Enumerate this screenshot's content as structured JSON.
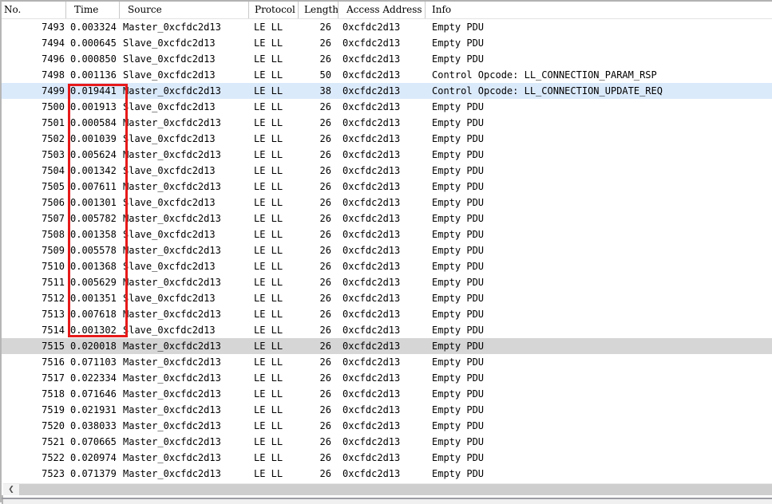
{
  "table": {
    "columns": [
      {
        "id": "no",
        "label": "No."
      },
      {
        "id": "time",
        "label": "Time"
      },
      {
        "id": "source",
        "label": "Source"
      },
      {
        "id": "protocol",
        "label": "Protocol"
      },
      {
        "id": "length",
        "label": "Length"
      },
      {
        "id": "access",
        "label": "Access Address"
      },
      {
        "id": "info",
        "label": "Info"
      }
    ],
    "rows": [
      {
        "no": "7493",
        "time": "0.003324",
        "source": "Master_0xcfdc2d13",
        "protocol": "LE LL",
        "length": "26",
        "access": "0xcfdc2d13",
        "info": "Empty PDU",
        "state": "normal"
      },
      {
        "no": "7494",
        "time": "0.000645",
        "source": "Slave_0xcfdc2d13",
        "protocol": "LE LL",
        "length": "26",
        "access": "0xcfdc2d13",
        "info": "Empty PDU",
        "state": "normal"
      },
      {
        "no": "7496",
        "time": "0.000850",
        "source": "Slave_0xcfdc2d13",
        "protocol": "LE LL",
        "length": "26",
        "access": "0xcfdc2d13",
        "info": "Empty PDU",
        "state": "normal"
      },
      {
        "no": "7498",
        "time": "0.001136",
        "source": "Slave_0xcfdc2d13",
        "protocol": "LE LL",
        "length": "50",
        "access": "0xcfdc2d13",
        "info": "Control Opcode: LL_CONNECTION_PARAM_RSP",
        "state": "normal"
      },
      {
        "no": "7499",
        "time": "0.019441",
        "source": "Master_0xcfdc2d13",
        "protocol": "LE LL",
        "length": "38",
        "access": "0xcfdc2d13",
        "info": "Control Opcode: LL_CONNECTION_UPDATE_REQ",
        "state": "selected-blue"
      },
      {
        "no": "7500",
        "time": "0.001913",
        "source": "Slave_0xcfdc2d13",
        "protocol": "LE LL",
        "length": "26",
        "access": "0xcfdc2d13",
        "info": "Empty PDU",
        "state": "normal"
      },
      {
        "no": "7501",
        "time": "0.000584",
        "source": "Master_0xcfdc2d13",
        "protocol": "LE LL",
        "length": "26",
        "access": "0xcfdc2d13",
        "info": "Empty PDU",
        "state": "normal"
      },
      {
        "no": "7502",
        "time": "0.001039",
        "source": "Slave_0xcfdc2d13",
        "protocol": "LE LL",
        "length": "26",
        "access": "0xcfdc2d13",
        "info": "Empty PDU",
        "state": "normal"
      },
      {
        "no": "7503",
        "time": "0.005624",
        "source": "Master_0xcfdc2d13",
        "protocol": "LE LL",
        "length": "26",
        "access": "0xcfdc2d13",
        "info": "Empty PDU",
        "state": "normal"
      },
      {
        "no": "7504",
        "time": "0.001342",
        "source": "Slave_0xcfdc2d13",
        "protocol": "LE LL",
        "length": "26",
        "access": "0xcfdc2d13",
        "info": "Empty PDU",
        "state": "normal"
      },
      {
        "no": "7505",
        "time": "0.007611",
        "source": "Master_0xcfdc2d13",
        "protocol": "LE LL",
        "length": "26",
        "access": "0xcfdc2d13",
        "info": "Empty PDU",
        "state": "normal"
      },
      {
        "no": "7506",
        "time": "0.001301",
        "source": "Slave_0xcfdc2d13",
        "protocol": "LE LL",
        "length": "26",
        "access": "0xcfdc2d13",
        "info": "Empty PDU",
        "state": "normal"
      },
      {
        "no": "7507",
        "time": "0.005782",
        "source": "Master_0xcfdc2d13",
        "protocol": "LE LL",
        "length": "26",
        "access": "0xcfdc2d13",
        "info": "Empty PDU",
        "state": "normal"
      },
      {
        "no": "7508",
        "time": "0.001358",
        "source": "Slave_0xcfdc2d13",
        "protocol": "LE LL",
        "length": "26",
        "access": "0xcfdc2d13",
        "info": "Empty PDU",
        "state": "normal"
      },
      {
        "no": "7509",
        "time": "0.005578",
        "source": "Master_0xcfdc2d13",
        "protocol": "LE LL",
        "length": "26",
        "access": "0xcfdc2d13",
        "info": "Empty PDU",
        "state": "normal"
      },
      {
        "no": "7510",
        "time": "0.001368",
        "source": "Slave_0xcfdc2d13",
        "protocol": "LE LL",
        "length": "26",
        "access": "0xcfdc2d13",
        "info": "Empty PDU",
        "state": "normal"
      },
      {
        "no": "7511",
        "time": "0.005629",
        "source": "Master_0xcfdc2d13",
        "protocol": "LE LL",
        "length": "26",
        "access": "0xcfdc2d13",
        "info": "Empty PDU",
        "state": "normal"
      },
      {
        "no": "7512",
        "time": "0.001351",
        "source": "Slave_0xcfdc2d13",
        "protocol": "LE LL",
        "length": "26",
        "access": "0xcfdc2d13",
        "info": "Empty PDU",
        "state": "normal"
      },
      {
        "no": "7513",
        "time": "0.007618",
        "source": "Master_0xcfdc2d13",
        "protocol": "LE LL",
        "length": "26",
        "access": "0xcfdc2d13",
        "info": "Empty PDU",
        "state": "normal"
      },
      {
        "no": "7514",
        "time": "0.001302",
        "source": "Slave_0xcfdc2d13",
        "protocol": "LE LL",
        "length": "26",
        "access": "0xcfdc2d13",
        "info": "Empty PDU",
        "state": "normal"
      },
      {
        "no": "7515",
        "time": "0.020018",
        "source": "Master_0xcfdc2d13",
        "protocol": "LE LL",
        "length": "26",
        "access": "0xcfdc2d13",
        "info": "Empty PDU",
        "state": "selected-gray"
      },
      {
        "no": "7516",
        "time": "0.071103",
        "source": "Master_0xcfdc2d13",
        "protocol": "LE LL",
        "length": "26",
        "access": "0xcfdc2d13",
        "info": "Empty PDU",
        "state": "normal"
      },
      {
        "no": "7517",
        "time": "0.022334",
        "source": "Master_0xcfdc2d13",
        "protocol": "LE LL",
        "length": "26",
        "access": "0xcfdc2d13",
        "info": "Empty PDU",
        "state": "normal"
      },
      {
        "no": "7518",
        "time": "0.071646",
        "source": "Master_0xcfdc2d13",
        "protocol": "LE LL",
        "length": "26",
        "access": "0xcfdc2d13",
        "info": "Empty PDU",
        "state": "normal"
      },
      {
        "no": "7519",
        "time": "0.021931",
        "source": "Master_0xcfdc2d13",
        "protocol": "LE LL",
        "length": "26",
        "access": "0xcfdc2d13",
        "info": "Empty PDU",
        "state": "normal"
      },
      {
        "no": "7520",
        "time": "0.038033",
        "source": "Master_0xcfdc2d13",
        "protocol": "LE LL",
        "length": "26",
        "access": "0xcfdc2d13",
        "info": "Empty PDU",
        "state": "normal"
      },
      {
        "no": "7521",
        "time": "0.070665",
        "source": "Master_0xcfdc2d13",
        "protocol": "LE LL",
        "length": "26",
        "access": "0xcfdc2d13",
        "info": "Empty PDU",
        "state": "normal"
      },
      {
        "no": "7522",
        "time": "0.020974",
        "source": "Master_0xcfdc2d13",
        "protocol": "LE LL",
        "length": "26",
        "access": "0xcfdc2d13",
        "info": "Empty PDU",
        "state": "normal"
      },
      {
        "no": "7523",
        "time": "0.071379",
        "source": "Master_0xcfdc2d13",
        "protocol": "LE LL",
        "length": "26",
        "access": "0xcfdc2d13",
        "info": "Empty PDU",
        "state": "normal"
      }
    ]
  },
  "annotation": {
    "shape": "rectangle",
    "purpose": "highlights Time column values of rows 7499-7514",
    "color": "#e71a1a"
  },
  "scrollbar": {
    "left_arrow_glyph": "❮"
  },
  "colors": {
    "selected_row_blue": "#dbeafb",
    "selected_row_gray": "#d6d6d6",
    "scrollbar_track": "#cecece",
    "annotation_red": "#e71a1a",
    "header_separator": "#c9c9c9"
  }
}
